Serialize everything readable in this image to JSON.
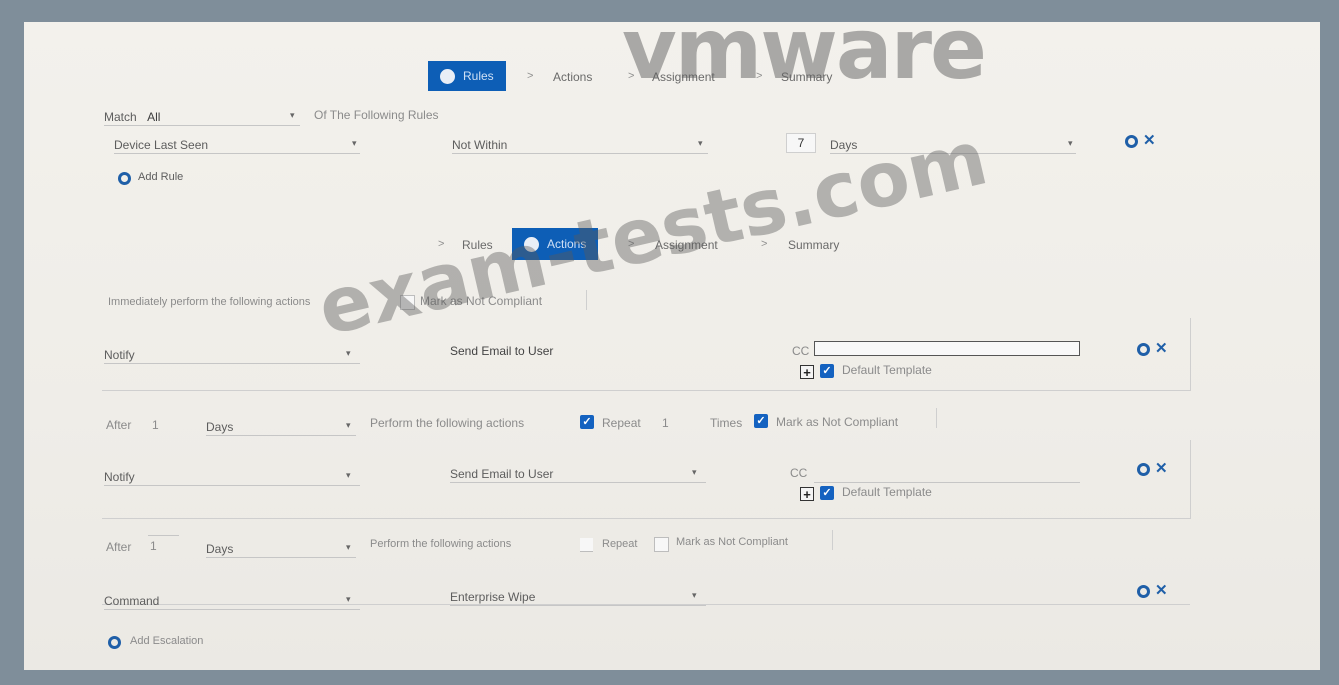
{
  "watermarks": {
    "top": "vmware",
    "diagonal": "exam-tests.com"
  },
  "rules_wizard": {
    "step1": "Rules",
    "step2": "Actions",
    "step3": "Assignment",
    "step4": "Summary",
    "separator": ">"
  },
  "match_row": {
    "label": "Match",
    "value": "All",
    "suffix": "Of The Following Rules"
  },
  "rule": {
    "attribute": "Device Last Seen",
    "operator": "Not Within",
    "number": "7",
    "unit": "Days"
  },
  "add_rule_label": "Add Rule",
  "actions_wizard": {
    "step1": "Rules",
    "step2": "Actions",
    "step3": "Assignment",
    "step4": "Summary",
    "separator": ">"
  },
  "immediate": {
    "label": "Immediately perform the following actions",
    "mark_label": "Mark as Not Compliant"
  },
  "action1": {
    "type": "Notify",
    "target": "Send Email to User",
    "cc_label": "CC",
    "template_label": "Default Template"
  },
  "escalation1": {
    "after_label": "After",
    "after_value": "1",
    "unit": "Days",
    "perform_label": "Perform the following actions",
    "repeat_label": "Repeat",
    "repeat_value": "1",
    "times_label": "Times",
    "mark_label": "Mark as Not Compliant"
  },
  "action2": {
    "type": "Notify",
    "target": "Send Email to User",
    "cc_label": "CC",
    "template_label": "Default Template"
  },
  "escalation2": {
    "after_label": "After",
    "after_value": "1",
    "unit": "Days",
    "perform_label": "Perform the following actions",
    "repeat_label": "Repeat",
    "mark_label": "Mark as Not Compliant"
  },
  "action3": {
    "type": "Command",
    "target": "Enterprise Wipe"
  },
  "add_escalation_label": "Add Escalation",
  "icons": {
    "dropdown": "▾",
    "check": "✓",
    "plus": "+",
    "close": "✕"
  }
}
